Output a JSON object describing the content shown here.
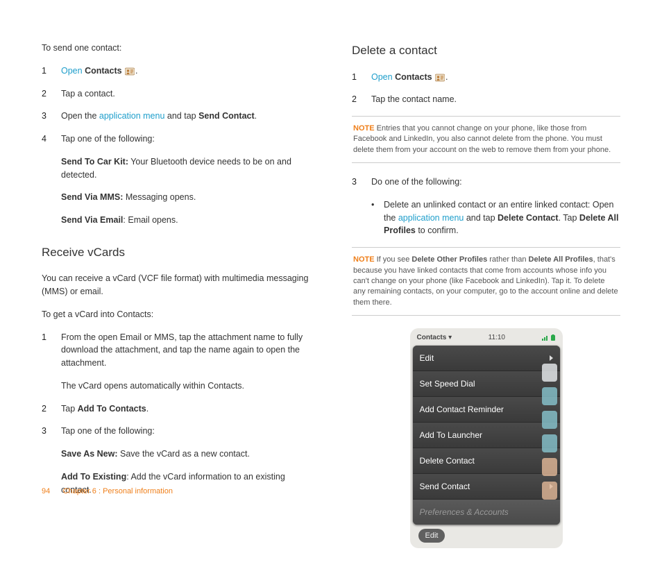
{
  "colLeft": {
    "introSendOne": "To send one contact:",
    "step1": {
      "num": "1",
      "open": "Open",
      "contacts": "Contacts",
      "period": "."
    },
    "step2": {
      "num": "2",
      "text": "Tap a contact."
    },
    "step3": {
      "num": "3",
      "pre": "Open the ",
      "link": "application menu",
      "mid": " and tap ",
      "bold": "Send Contact",
      "post": "."
    },
    "step4": {
      "num": "4",
      "text": "Tap one of the following:"
    },
    "carKit": {
      "bold": "Send To Car Kit:",
      "text": " Your Bluetooth device needs to be on and detected."
    },
    "mms": {
      "bold": "Send Via MMS:",
      "text": " Messaging opens."
    },
    "email": {
      "bold": "Send Via Email",
      "text": ": Email opens."
    },
    "h2vcards": "Receive vCards",
    "vcardIntro": "You can receive a vCard (VCF file format) with multimedia messaging (MMS) or email.",
    "vcardGet": "To get a vCard into Contacts:",
    "vstep1": {
      "num": "1",
      "text": "From the open Email or MMS, tap the attachment name to fully download the attachment, and tap the name again to open the attachment."
    },
    "vautoc": "The vCard opens automatically within Contacts.",
    "vstep2": {
      "num": "2",
      "pre": "Tap ",
      "bold": "Add To Contacts",
      "post": "."
    },
    "vstep3": {
      "num": "3",
      "text": "Tap one of the following:"
    },
    "saveNew": {
      "bold": "Save As New:",
      "text": " Save the vCard as a new contact."
    },
    "addExist": {
      "bold": "Add To Existing",
      "text": ": Add the vCard information to an existing contact."
    }
  },
  "colRight": {
    "h2delete": "Delete a contact",
    "dstep1": {
      "num": "1",
      "open": "Open",
      "contacts": "Contacts",
      "period": "."
    },
    "dstep2": {
      "num": "2",
      "text": "Tap the contact name."
    },
    "note1": {
      "label": "NOTE",
      "text": "  Entries that you cannot change on your phone, like those from Facebook and LinkedIn, you also cannot delete from the phone. You must delete them from your account on the web to remove them from your phone."
    },
    "dstep3": {
      "num": "3",
      "text": "Do one of the following:"
    },
    "bullet": {
      "pre": "Delete an unlinked contact or an entire linked contact: Open the ",
      "link": "application menu",
      "mid": " and tap ",
      "bold1": "Delete Contact",
      "mid2": ". Tap ",
      "bold2": "Delete All Profiles",
      "post": " to confirm."
    },
    "note2": {
      "label": "NOTE",
      "pre": "  If you see ",
      "bold1": "Delete Other Profiles",
      "mid": " rather than ",
      "bold2": "Delete All Profiles",
      "post": ", that's because you have linked contacts that come from accounts whose info you can't change on your phone (like Facebook and LinkedIn). Tap it. To delete any remaining contacts, on your computer, go to the account online and delete them there."
    },
    "phone": {
      "title": "Contacts",
      "time": "11:10",
      "menu": [
        "Edit",
        "Set Speed Dial",
        "Add Contact Reminder",
        "Add To Launcher",
        "Delete Contact",
        "Send Contact"
      ],
      "disabled": "Preferences & Accounts",
      "pill": "Edit"
    }
  },
  "footer": {
    "page": "94",
    "chapter": "Chapter 6 : Personal information"
  }
}
